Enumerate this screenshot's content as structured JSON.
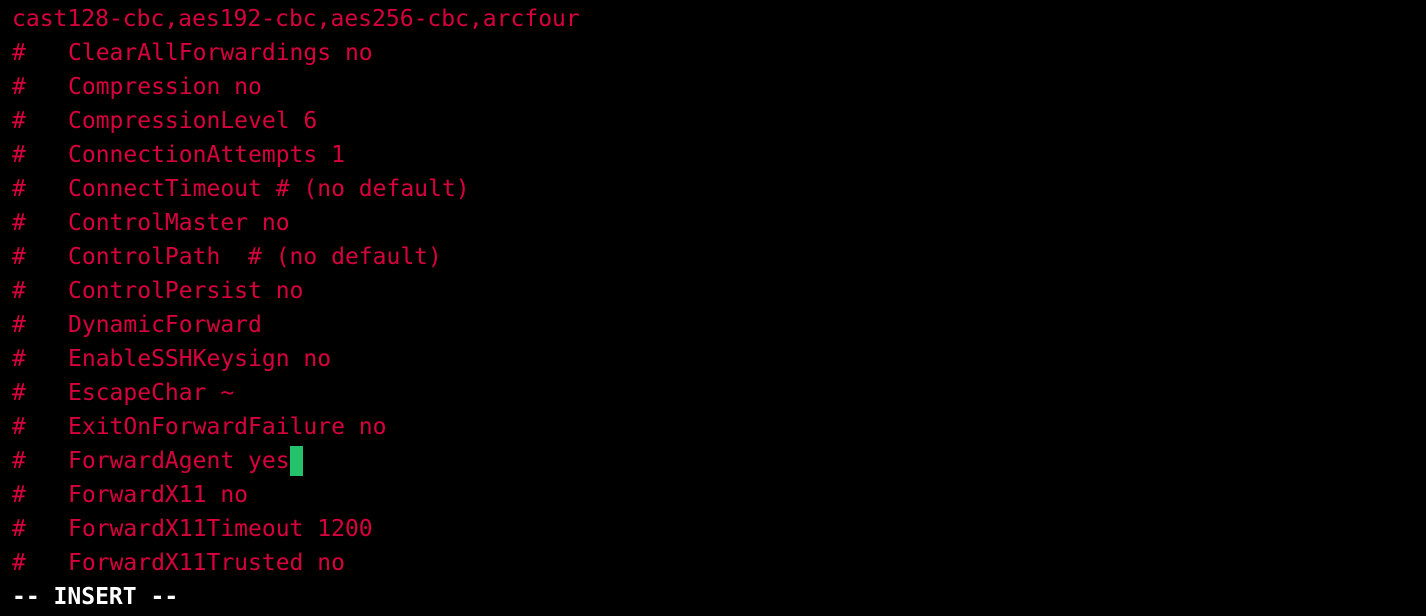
{
  "editor": {
    "first_line": "cast128-cbc,aes192-cbc,aes256-cbc,arcfour",
    "lines": [
      {
        "marker": "#",
        "text": "ClearAllForwardings no"
      },
      {
        "marker": "#",
        "text": "Compression no"
      },
      {
        "marker": "#",
        "text": "CompressionLevel 6"
      },
      {
        "marker": "#",
        "text": "ConnectionAttempts 1"
      },
      {
        "marker": "#",
        "text": "ConnectTimeout # (no default)"
      },
      {
        "marker": "#",
        "text": "ControlMaster no"
      },
      {
        "marker": "#",
        "text": "ControlPath  # (no default)"
      },
      {
        "marker": "#",
        "text": "ControlPersist no"
      },
      {
        "marker": "#",
        "text": "DynamicForward"
      },
      {
        "marker": "#",
        "text": "EnableSSHKeysign no"
      },
      {
        "marker": "#",
        "text": "EscapeChar ~"
      },
      {
        "marker": "#",
        "text": "ExitOnForwardFailure no"
      },
      {
        "marker": "#",
        "text": "ForwardAgent yes"
      },
      {
        "marker": "#",
        "text": "ForwardX11 no"
      },
      {
        "marker": "#",
        "text": "ForwardX11Timeout 1200"
      },
      {
        "marker": "#",
        "text": "ForwardX11Trusted no"
      }
    ],
    "cursor_line_index": 12,
    "text_color": "#d8003c",
    "cursor_color": "#25c26c",
    "background_color": "#000000"
  },
  "status": {
    "mode": "-- INSERT --"
  }
}
